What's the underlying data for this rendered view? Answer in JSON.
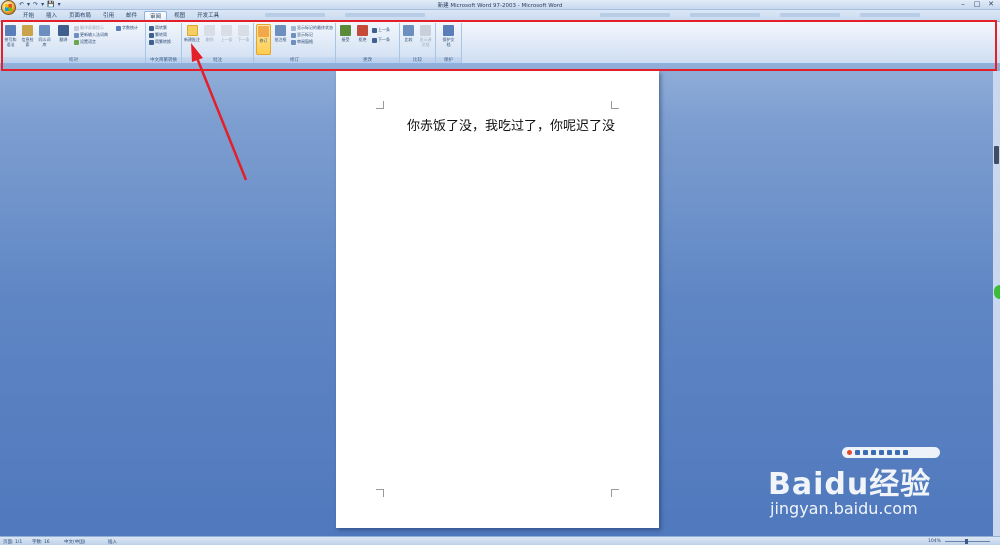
{
  "window": {
    "title": "新建 Microsoft Word 97-2003 - Microsoft Word",
    "controls": [
      "–",
      "□",
      "✕"
    ]
  },
  "quick_access": [
    "↶",
    "▾",
    "↷",
    "▾",
    "💾",
    "▾"
  ],
  "tabs": [
    "开始",
    "插入",
    "页面布局",
    "引用",
    "邮件",
    "审阅",
    "视图",
    "开发工具"
  ],
  "active_tab": "审阅",
  "ribbon": {
    "groups": [
      {
        "label": "校对",
        "big": [
          {
            "name": "spelling",
            "label": "拼写和语法",
            "color": "#5a7fb8"
          },
          {
            "name": "research",
            "label": "信息检索",
            "color": "#c9a24a"
          },
          {
            "name": "thesaurus",
            "label": "同义词库",
            "color": "#6d8fbf"
          },
          {
            "name": "translate",
            "label": "翻译",
            "color": "#3f5f8f"
          }
        ],
        "small": [
          {
            "name": "translate-tip",
            "label": "翻译屏幕提示",
            "gray": true
          },
          {
            "name": "set-language",
            "label": "设置语言",
            "gray": false
          },
          {
            "name": "word-count",
            "label": "字数统计",
            "gray": false
          },
          {
            "name": "ime",
            "label": "更新输入法词典",
            "gray": false
          }
        ]
      },
      {
        "label": "中文简繁转换",
        "small": [
          {
            "name": "to-traditional",
            "label": "简转繁",
            "gray": false
          },
          {
            "name": "to-simplified",
            "label": "繁转简",
            "gray": false
          },
          {
            "name": "convert",
            "label": "简繁转换",
            "gray": false
          }
        ]
      },
      {
        "label": "批注",
        "big": [
          {
            "name": "new-comment",
            "label": "新建批注",
            "color": "#f4cf62",
            "highlight": true
          },
          {
            "name": "delete-comment",
            "label": "删除",
            "color": "#d8dde6"
          },
          {
            "name": "prev-comment",
            "label": "上一条",
            "color": "#d8dde6"
          },
          {
            "name": "next-comment",
            "label": "下一条",
            "color": "#d8dde6"
          }
        ]
      },
      {
        "label": "修订",
        "big": [
          {
            "name": "track-changes",
            "label": "修订",
            "color": "#f2a84a",
            "highlight": true
          },
          {
            "name": "balloons",
            "label": "批注框",
            "color": "#6d8fbf"
          }
        ],
        "small": [
          {
            "name": "final-markup",
            "label": "显示标记的最终状态",
            "gray": false
          },
          {
            "name": "show-markup",
            "label": "显示标记",
            "gray": false
          },
          {
            "name": "reviewing-pane",
            "label": "审阅窗格",
            "gray": false
          }
        ]
      },
      {
        "label": "更改",
        "big": [
          {
            "name": "accept",
            "label": "接受",
            "color": "#5a8a3a"
          },
          {
            "name": "reject",
            "label": "拒绝",
            "color": "#c44a3a"
          }
        ],
        "small": [
          {
            "name": "previous",
            "label": "上一条",
            "gray": false
          },
          {
            "name": "next",
            "label": "下一条",
            "gray": false
          }
        ]
      },
      {
        "label": "比较",
        "big": [
          {
            "name": "compare",
            "label": "比较",
            "color": "#6d8fbf"
          },
          {
            "name": "show-source",
            "label": "显示源文档",
            "color": "#c8d0dc"
          }
        ]
      },
      {
        "label": "保护",
        "big": [
          {
            "name": "protect",
            "label": "保护文档",
            "color": "#5a7fb8"
          }
        ]
      }
    ]
  },
  "document": {
    "text": "你赤饭了没，我吃过了，你呢迟了没"
  },
  "statusbar": {
    "page": "页面: 1/1",
    "words": "字数: 16",
    "language": "中文(中国)",
    "mode": "插入",
    "zoom": "104%"
  },
  "watermark": {
    "brand": "Baidu经验",
    "url": "jingyan.baidu.com"
  },
  "colors": {
    "annotation": "#e3202a",
    "background_top": "#a9c2e3",
    "background_bottom": "#4f78bd"
  }
}
